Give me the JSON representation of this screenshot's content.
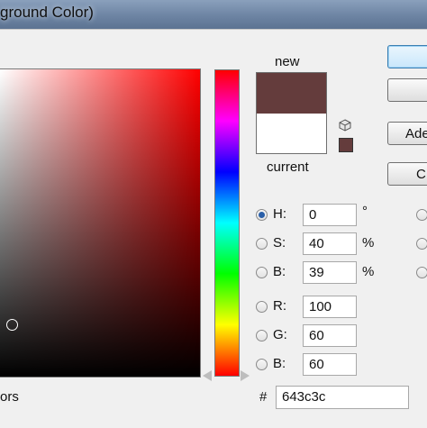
{
  "window": {
    "title": "ground Color)"
  },
  "swatch": {
    "new_label": "new",
    "current_label": "current",
    "new_color": "#643c3c",
    "current_color": "#ffffff"
  },
  "buttons": {
    "add_label": "Ade",
    "c_label": "C"
  },
  "hsb": {
    "h": {
      "label": "H:",
      "value": "0",
      "unit": "°"
    },
    "s": {
      "label": "S:",
      "value": "40",
      "unit": "%"
    },
    "b": {
      "label": "B:",
      "value": "39",
      "unit": "%"
    }
  },
  "rgb": {
    "r": {
      "label": "R:",
      "value": "100"
    },
    "g": {
      "label": "G:",
      "value": "60"
    },
    "b": {
      "label": "B:",
      "value": "60"
    }
  },
  "hex": {
    "label": "#",
    "value": "643c3c"
  },
  "footer": {
    "only_web_colors_label": "ors"
  }
}
